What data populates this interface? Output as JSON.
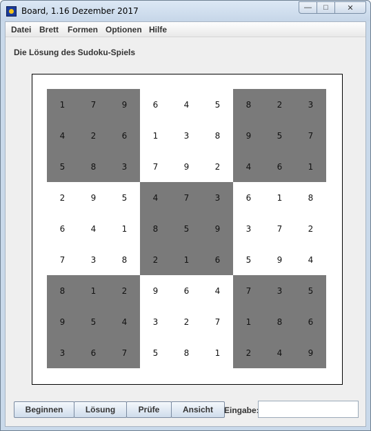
{
  "window": {
    "title": "Board, 1.16 Dezember 2017",
    "icon": "board-app-icon",
    "controls": [
      "minimize-icon",
      "maximize-icon",
      "close-icon"
    ]
  },
  "menu": [
    "Datei",
    "Brett",
    "Formen",
    "Optionen",
    "Hilfe"
  ],
  "heading": "Die Lösung des Sudoku-Spiels",
  "board": {
    "rows": [
      [
        "1",
        "7",
        "9",
        "6",
        "4",
        "5",
        "8",
        "2",
        "3"
      ],
      [
        "4",
        "2",
        "6",
        "1",
        "3",
        "8",
        "9",
        "5",
        "7"
      ],
      [
        "5",
        "8",
        "3",
        "7",
        "9",
        "2",
        "4",
        "6",
        "1"
      ],
      [
        "2",
        "9",
        "5",
        "4",
        "7",
        "3",
        "6",
        "1",
        "8"
      ],
      [
        "6",
        "4",
        "1",
        "8",
        "5",
        "9",
        "3",
        "7",
        "2"
      ],
      [
        "7",
        "3",
        "8",
        "2",
        "1",
        "6",
        "5",
        "9",
        "4"
      ],
      [
        "8",
        "1",
        "2",
        "9",
        "6",
        "4",
        "7",
        "3",
        "5"
      ],
      [
        "9",
        "5",
        "4",
        "3",
        "2",
        "7",
        "1",
        "8",
        "6"
      ],
      [
        "3",
        "6",
        "7",
        "5",
        "8",
        "1",
        "2",
        "4",
        "9"
      ]
    ],
    "dark_color": "#7a7a7a",
    "light_color": "#ffffff"
  },
  "buttons": [
    "Beginnen",
    "Lösung",
    "Prüfe",
    "Ansicht"
  ],
  "input": {
    "label": "Eingabe:",
    "value": ""
  }
}
